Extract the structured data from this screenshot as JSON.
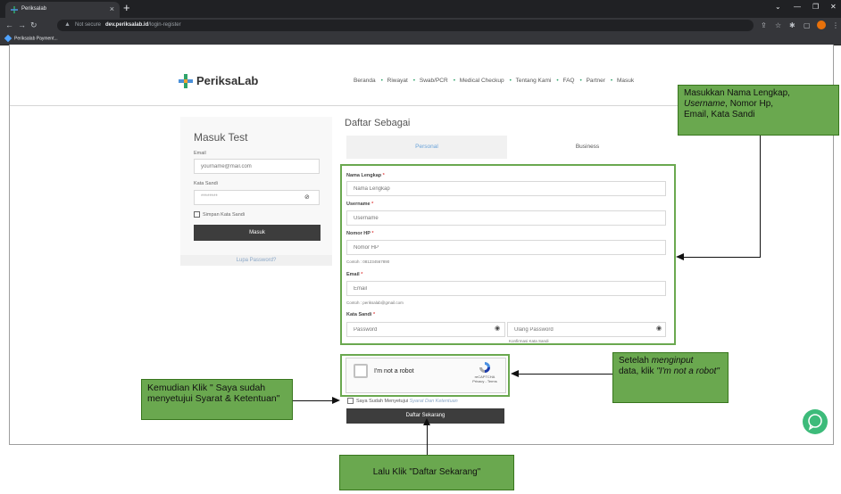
{
  "browser": {
    "tab_title": "Periksalab",
    "new_tab": "+",
    "address_warning": "Not secure",
    "address_host": "dev.periksalab.id",
    "address_path": "/login-register",
    "bookmark": "Periksalab Payment..."
  },
  "site": {
    "logo_text": "PeriksaLab",
    "menu": [
      "Beranda",
      "Riwayat",
      "Swab/PCR",
      "Medical Checkup",
      "Tentang Kami",
      "FAQ",
      "Partner",
      "Masuk"
    ],
    "menu_separator": "•"
  },
  "login": {
    "title": "Masuk Test",
    "email_label": "Email",
    "email_placeholder": "yourname@mail.com",
    "password_label": "Kata Sandi",
    "password_value": "********",
    "remember_label": "Simpan Kata Sandi",
    "submit_label": "Masuk",
    "forgot_label": "Lupa Password?"
  },
  "register": {
    "title": "Daftar Sebagai",
    "tabs": [
      "Personal",
      "Business"
    ],
    "active_tab": "Personal",
    "fields": {
      "name_label": "Nama Lengkap",
      "name_placeholder": "Nama Lengkap",
      "username_label": "Username",
      "username_placeholder": "Username",
      "phone_label": "Nomor HP",
      "phone_placeholder": "Nomor HP",
      "phone_hint": "Contoh : 081234567890",
      "email_label": "Email",
      "email_placeholder": "Email",
      "email_hint": "Contoh : periksalab@gmail.com",
      "password_label": "Kata Sandi",
      "password_placeholder": "Password",
      "confirm_placeholder": "Ulang Password",
      "confirm_hint": "Konfirmasi Kata Sandi",
      "required_mark": "*"
    },
    "captcha_label": "I'm not a robot",
    "captcha_brand": "reCAPTCHA",
    "captcha_terms": "Privacy - Terms",
    "terms_text": "Saya Sudah Menyetujui",
    "terms_link": "Syarat Dan Ketentuan",
    "submit_label": "Daftar Sekarang"
  },
  "annotations": {
    "fields_note_line1": "Masukkan Nama Lengkap,",
    "fields_note_italic": "Username",
    "fields_note_line2_rest": ", Nomor Hp,",
    "fields_note_line3": "Email, Kata Sandi",
    "captcha_note_pre": "Setelah ",
    "captcha_note_italic": "menginput",
    "captcha_note_mid": "data, klik ",
    "captcha_note_italic2": "\"I'm not a robot\"",
    "terms_note": "Kemudian Klik  \" Saya sudah menyetujui Syarat & Ketentuan\"",
    "submit_note": "Lalu Klik \"Daftar Sekarang\""
  },
  "colors": {
    "annotation_green": "#6aa84f",
    "brand_green": "#2fa36b",
    "link_blue": "#6aa3d9",
    "button_dark": "#3d3d3d"
  }
}
